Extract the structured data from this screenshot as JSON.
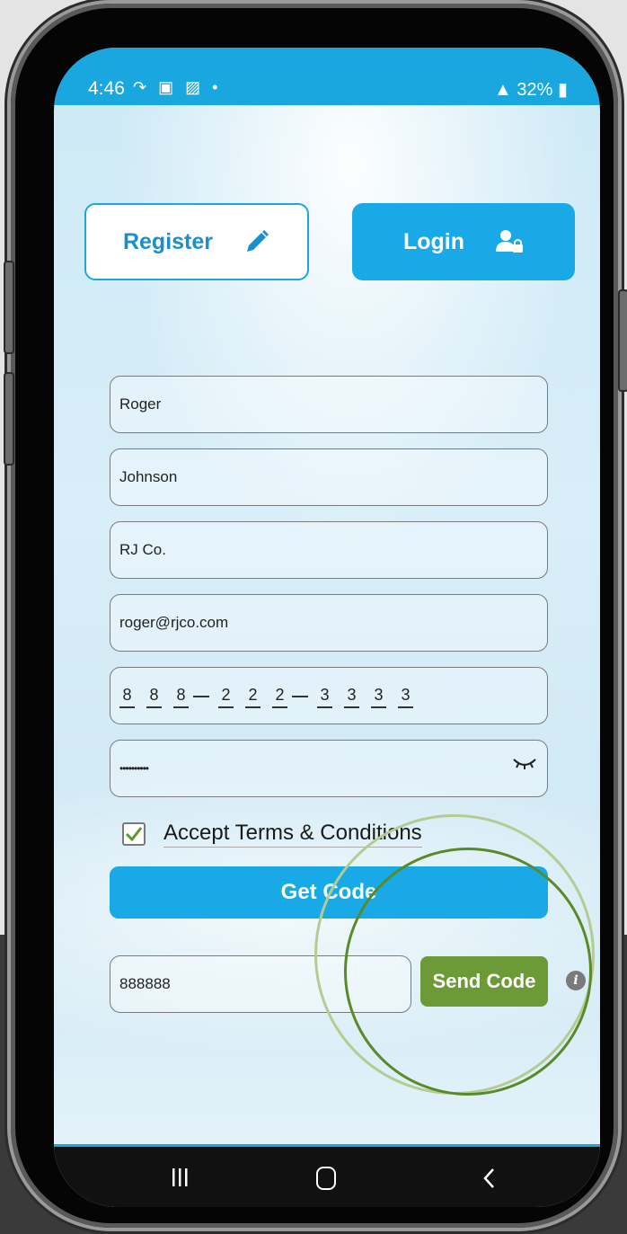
{
  "status_bar": {
    "time": "4:46",
    "notification_icons": "↷ ▣ ▨ •",
    "battery": "32%"
  },
  "tabs": {
    "register_label": "Register",
    "login_label": "Login"
  },
  "form": {
    "first_name": "Roger",
    "last_name": "Johnson",
    "company": "RJ Co.",
    "email": "roger@rjco.com",
    "phone_digits": [
      "8",
      "8",
      "8",
      "2",
      "2",
      "2",
      "3",
      "3",
      "3",
      "3"
    ],
    "password_masked": "••••••••••",
    "terms_label": "Accept Terms & Conditions",
    "terms_checked": true,
    "get_code_label": "Get Code",
    "verification_code": "888888",
    "send_code_label": "Send Code"
  },
  "nav_bar": {
    "recent_icon": "recent-apps-icon",
    "home_icon": "home-icon",
    "back_icon": "back-icon"
  },
  "colors": {
    "primary_blue": "#19a9e6",
    "send_code_green": "#6c9a36",
    "highlight_ring_dark": "#5a8a27",
    "highlight_ring_light": "#b4cc92"
  }
}
